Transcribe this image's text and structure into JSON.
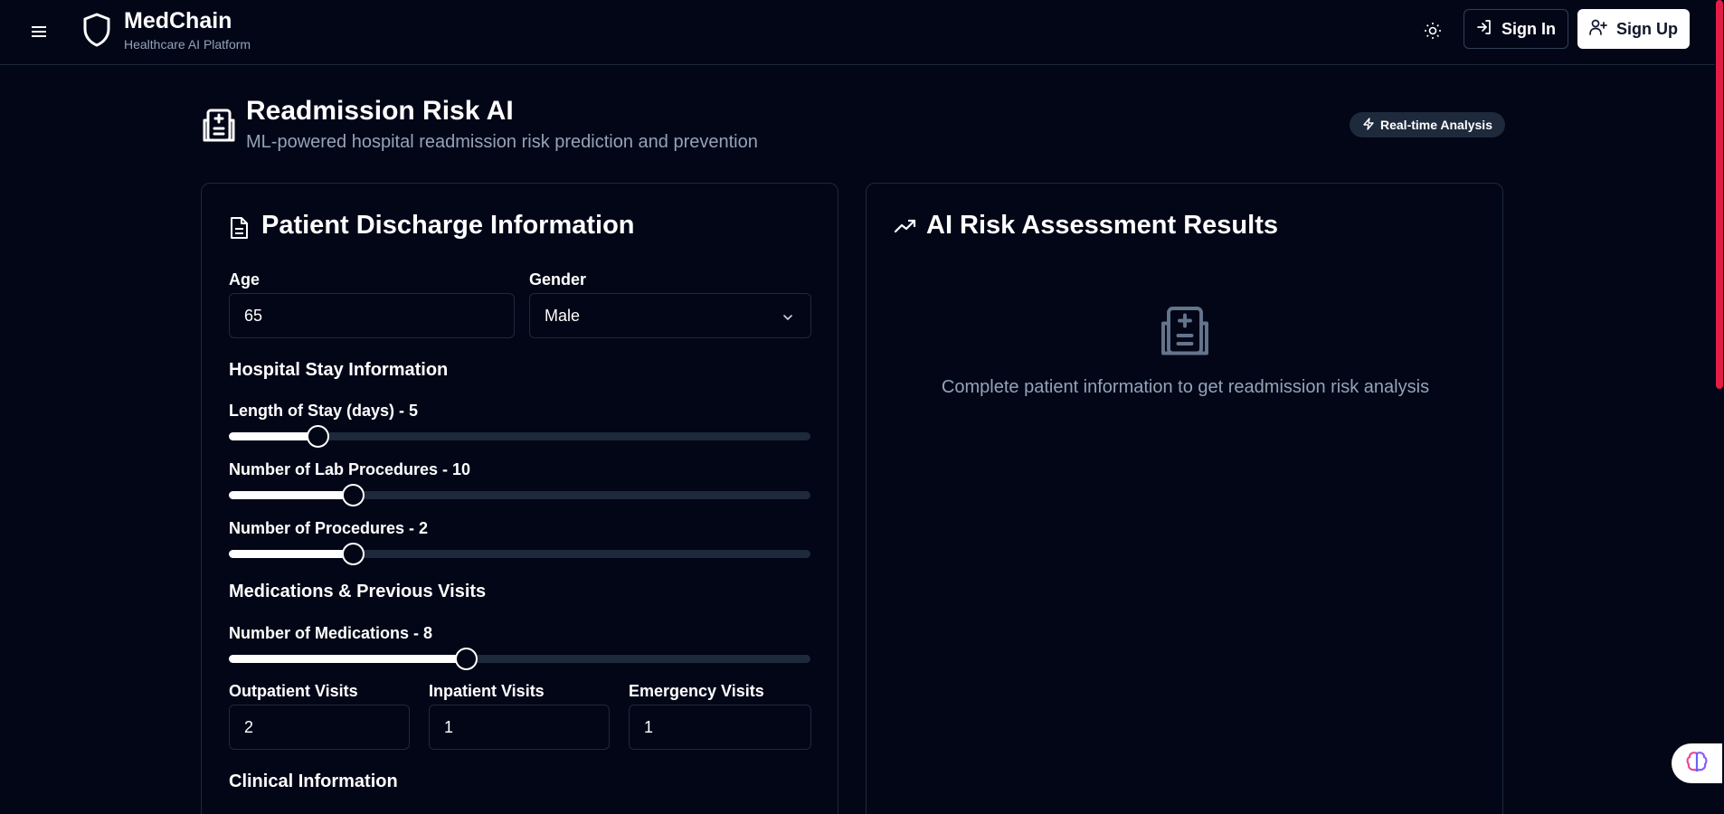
{
  "header": {
    "brand_name": "MedChain",
    "brand_tagline": "Healthcare AI Platform",
    "sign_in_label": "Sign In",
    "sign_up_label": "Sign Up"
  },
  "page": {
    "title": "Readmission Risk AI",
    "subtitle": "ML-powered hospital readmission risk prediction and prevention",
    "badge": "Real-time Analysis"
  },
  "form": {
    "title": "Patient Discharge Information",
    "age": {
      "label": "Age",
      "value": "65"
    },
    "gender": {
      "label": "Gender",
      "value": "Male"
    },
    "stay_section": "Hospital Stay Information",
    "sliders": [
      {
        "label": "Length of Stay (days) - 5",
        "fraction": 0.153
      },
      {
        "label": "Number of Lab Procedures - 10",
        "fraction": 0.213
      },
      {
        "label": "Number of Procedures - 2",
        "fraction": 0.213
      },
      {
        "label": "Number of Medications - 8",
        "fraction": 0.407
      }
    ],
    "meds_section": "Medications & Previous Visits",
    "outpatient": {
      "label": "Outpatient Visits",
      "value": "2"
    },
    "inpatient": {
      "label": "Inpatient Visits",
      "value": "1"
    },
    "emergency": {
      "label": "Emergency Visits",
      "value": "1"
    },
    "clinical_section": "Clinical Information"
  },
  "results": {
    "title": "AI Risk Assessment Results",
    "empty_message": "Complete patient information to get readmission risk analysis"
  },
  "colors": {
    "background": "#020617",
    "border": "#1e293b",
    "muted_text": "#94a3b8",
    "scroll_thumb": "#e11d48"
  },
  "icons": [
    "menu-icon",
    "shield-icon",
    "sun-icon",
    "log-in-icon",
    "user-plus-icon",
    "hospital-icon",
    "zap-icon",
    "file-text-icon",
    "trending-up-icon",
    "chevron-down-icon",
    "brain-icon"
  ]
}
